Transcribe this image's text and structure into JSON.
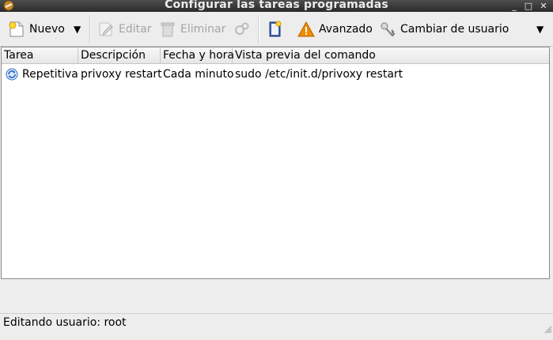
{
  "window": {
    "title": "Configurar las tareas programadas",
    "controls": {
      "minimize": "_",
      "maximize": "□",
      "close": "✕"
    }
  },
  "toolbar": {
    "new_label": "Nuevo",
    "edit_label": "Editar",
    "delete_label": "Eliminar",
    "advanced_label": "Avanzado",
    "change_user_label": "Cambiar de usuario"
  },
  "table": {
    "columns": [
      "Tarea",
      "Descripción",
      "Fecha y hora",
      "Vista previa del comando"
    ],
    "rows": [
      {
        "task": "Repetitiva",
        "description": "privoxy restart",
        "datetime": "Cada minuto",
        "command_preview": "sudo /etc/init.d/privoxy restart"
      }
    ]
  },
  "status": {
    "text": "Editando usuario: root"
  },
  "colors": {
    "titlebar": "#3a3a3a",
    "warning": "#f08a00",
    "refresh": "#2f6fc0"
  }
}
